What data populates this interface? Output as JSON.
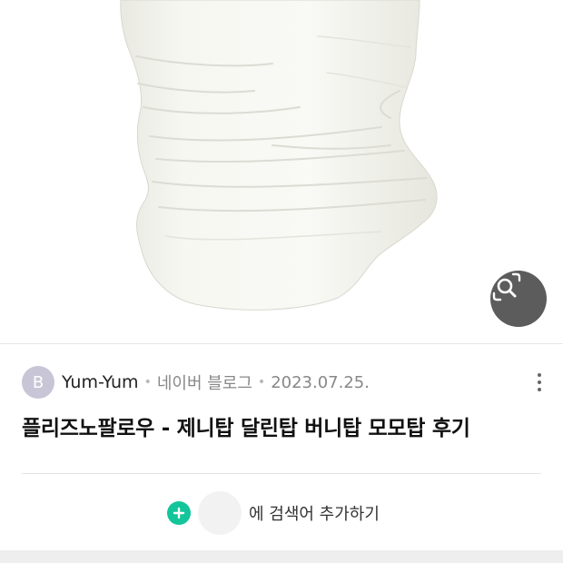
{
  "image": {
    "subject": "garment-photo"
  },
  "lens_button": {
    "icon": "image-search-icon"
  },
  "post": {
    "avatar_letter": "B",
    "author": "Yum-Yum",
    "separator": "•",
    "source": "네이버 블로그",
    "date": "2023.07.25.",
    "title": "플리즈노팔로우 - 제니탑 달린탑 버니탑 모모탑 후기",
    "more_icon": "more-vertical-icon"
  },
  "add_keyword": {
    "icon": "plus-icon",
    "label": "에 검색어 추가하기"
  },
  "colors": {
    "accent": "#12c59a",
    "avatar": "#c8c5d6",
    "lens_bg": "#464646"
  }
}
